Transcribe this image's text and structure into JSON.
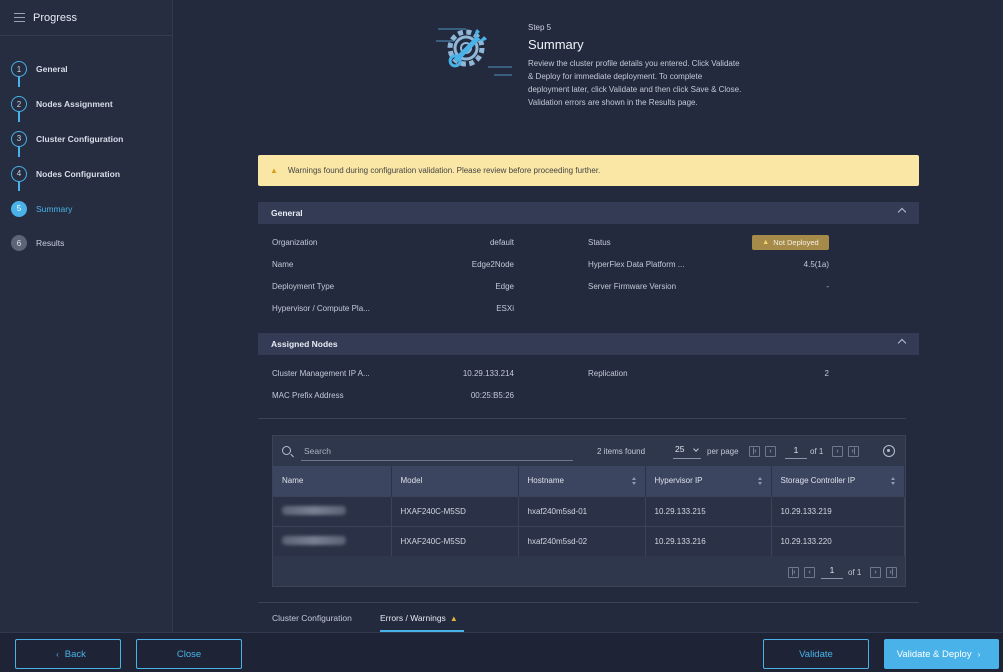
{
  "sidebar": {
    "title": "Progress",
    "steps": [
      {
        "num": "1",
        "label": "General"
      },
      {
        "num": "2",
        "label": "Nodes Assignment"
      },
      {
        "num": "3",
        "label": "Cluster Configuration"
      },
      {
        "num": "4",
        "label": "Nodes Configuration"
      },
      {
        "num": "5",
        "label": "Summary"
      },
      {
        "num": "6",
        "label": "Results"
      }
    ]
  },
  "header": {
    "step_no": "Step 5",
    "title": "Summary",
    "description": "Review the cluster profile details you entered. Click Validate & Deploy for immediate deployment. To complete deployment later, click Validate and then click Save & Close. Validation errors are shown in the Results page."
  },
  "warning": {
    "text": "Warnings found during configuration validation. Please review before proceeding further."
  },
  "general": {
    "title": "General",
    "organization_label": "Organization",
    "organization": "default",
    "name_label": "Name",
    "name": "Edge2Node",
    "deployment_type_label": "Deployment Type",
    "deployment_type": "Edge",
    "hypervisor_label": "Hypervisor / Compute Pla...",
    "hypervisor": "ESXi",
    "status_label": "Status",
    "status": "Not Deployed",
    "hx_platform_label": "HyperFlex Data Platform ...",
    "hx_platform": "4.5(1a)",
    "firmware_label": "Server Firmware Version",
    "firmware": "-"
  },
  "assigned": {
    "title": "Assigned Nodes",
    "mgmt_ip_label": "Cluster Management IP A...",
    "mgmt_ip": "10.29.133.214",
    "mac_label": "MAC Prefix Address",
    "mac": "00:25:B5:26",
    "replication_label": "Replication",
    "replication": "2"
  },
  "table": {
    "search_placeholder": "Search",
    "items_found": "2 items found",
    "per_page": "25",
    "per_page_label": "per page",
    "page": "1",
    "of": "of 1",
    "columns": [
      "Name",
      "Model",
      "Hostname",
      "Hypervisor IP",
      "Storage Controller IP"
    ],
    "rows": [
      {
        "model": "HXAF240C-M5SD",
        "hostname": "hxaf240m5sd-01",
        "hyp_ip": "10.29.133.215",
        "sc_ip": "10.29.133.219"
      },
      {
        "model": "HXAF240C-M5SD",
        "hostname": "hxaf240m5sd-02",
        "hyp_ip": "10.29.133.216",
        "sc_ip": "10.29.133.220"
      }
    ]
  },
  "tabs": {
    "cluster_config": "Cluster Configuration",
    "errors": "Errors / Warnings"
  },
  "footer": {
    "back": "Back",
    "close": "Close",
    "validate": "Validate",
    "validate_deploy": "Validate & Deploy"
  },
  "colors": {
    "accent": "#49b2e8",
    "warning_bg": "#fae7a5",
    "badge": "#a68a49"
  }
}
